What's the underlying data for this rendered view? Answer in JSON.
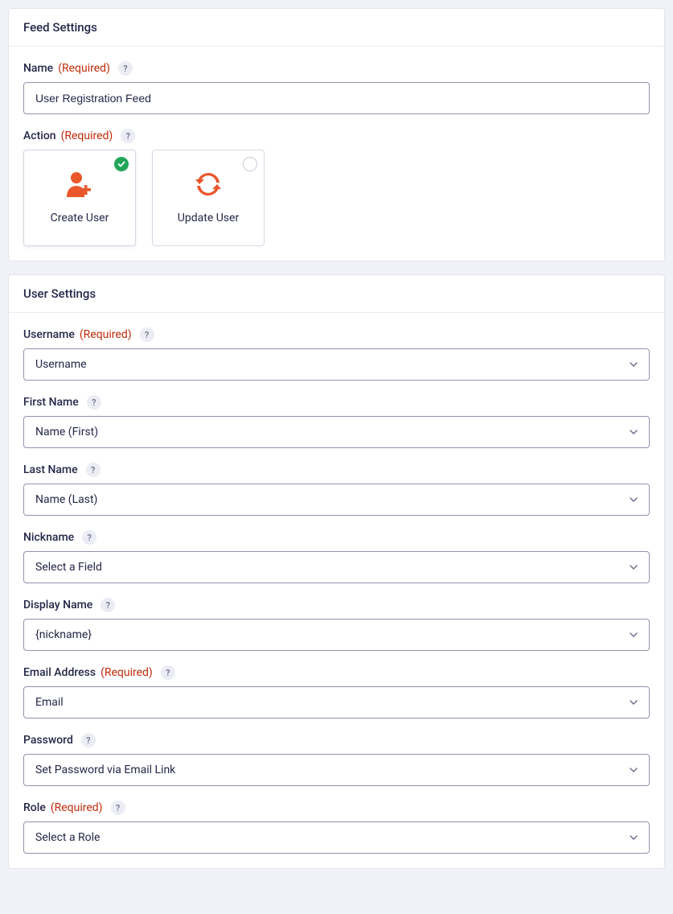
{
  "feed": {
    "title": "Feed Settings",
    "name_label": "Name",
    "name_value": "User Registration Feed",
    "action_label": "Action",
    "required_text": "(Required)",
    "actions": {
      "create": "Create User",
      "update": "Update User"
    }
  },
  "user": {
    "title": "User Settings",
    "fields": {
      "username": {
        "label": "Username",
        "required": true,
        "value": "Username"
      },
      "first_name": {
        "label": "First Name",
        "required": false,
        "value": "Name (First)"
      },
      "last_name": {
        "label": "Last Name",
        "required": false,
        "value": "Name (Last)"
      },
      "nickname": {
        "label": "Nickname",
        "required": false,
        "value": "Select a Field"
      },
      "display_name": {
        "label": "Display Name",
        "required": false,
        "value": "{nickname}"
      },
      "email": {
        "label": "Email Address",
        "required": true,
        "value": "Email"
      },
      "password": {
        "label": "Password",
        "required": false,
        "value": "Set Password via Email Link"
      },
      "role": {
        "label": "Role",
        "required": true,
        "value": "Select a Role"
      }
    }
  }
}
